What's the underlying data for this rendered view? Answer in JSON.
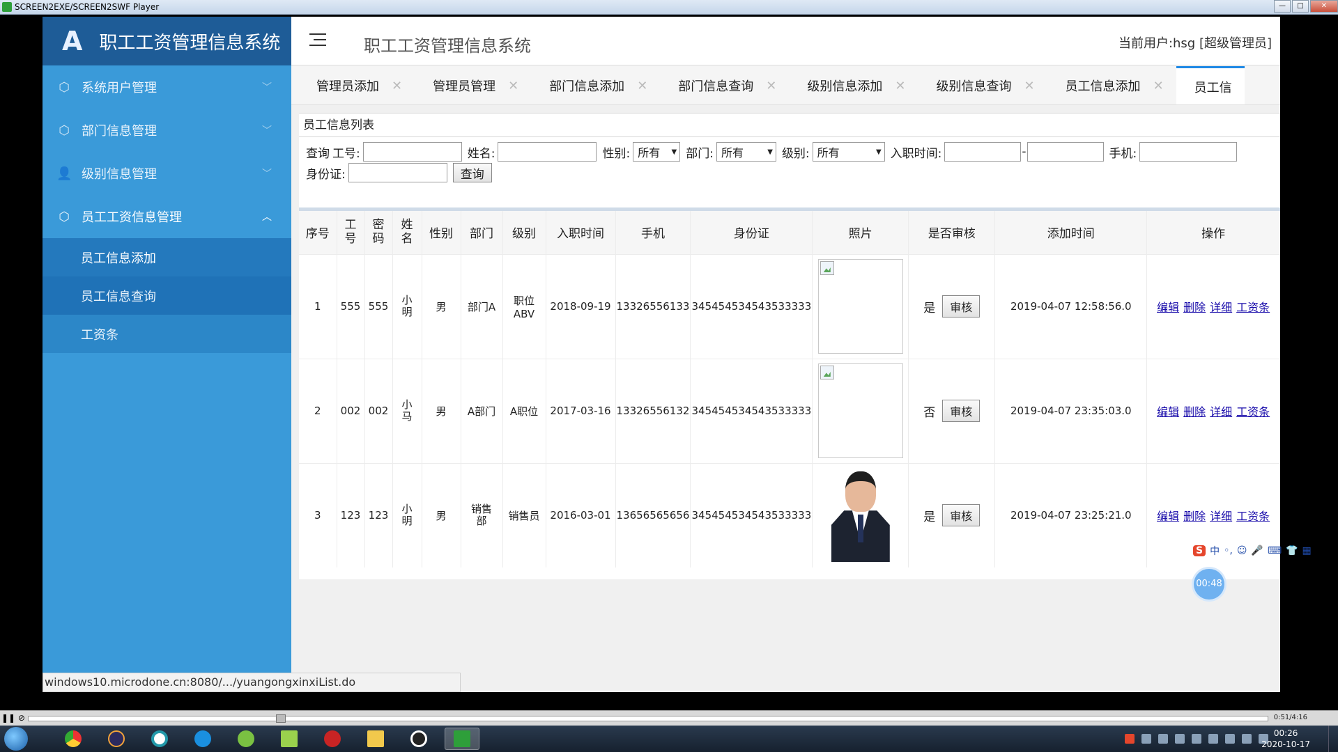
{
  "player": {
    "title": "SCREEN2EXE/SCREEN2SWF Player",
    "elapsed": "0:51/4:16",
    "progress": 0.2
  },
  "app": {
    "brand_logo": "A",
    "brand_title": "职工工资管理信息系统",
    "header_title": "职工工资管理信息系统",
    "current_user": "当前用户:hsg [超级管理员]"
  },
  "sidebar": {
    "menus": [
      {
        "label": "系统用户管理",
        "icon": "cube-icon"
      },
      {
        "label": "部门信息管理",
        "icon": "cube-icon"
      },
      {
        "label": "级别信息管理",
        "icon": "user-icon"
      },
      {
        "label": "员工工资信息管理",
        "icon": "cube-icon"
      }
    ],
    "submenu": [
      {
        "label": "员工信息添加"
      },
      {
        "label": "员工信息查询"
      },
      {
        "label": "工资条"
      }
    ]
  },
  "tabs": [
    {
      "label": "管理员添加"
    },
    {
      "label": "管理员管理"
    },
    {
      "label": "部门信息添加"
    },
    {
      "label": "部门信息查询"
    },
    {
      "label": "级别信息添加"
    },
    {
      "label": "级别信息查询"
    },
    {
      "label": "员工信息添加"
    },
    {
      "label": "员工信"
    }
  ],
  "panel": {
    "title": "员工信息列表"
  },
  "search": {
    "query_label": "查询",
    "job_no_label": "工号:",
    "name_label": "姓名:",
    "gender_label": "性别:",
    "gender_value": "所有",
    "dept_label": "部门:",
    "dept_value": "所有",
    "level_label": "级别:",
    "level_value": "所有",
    "hire_label": "入职时间:",
    "range_dash": "-",
    "phone_label": "手机:",
    "id_label": "身份证:",
    "submit_label": "查询"
  },
  "table": {
    "headers": [
      "序号",
      "工号",
      "密码",
      "姓名",
      "性别",
      "部门",
      "级别",
      "入职时间",
      "手机",
      "身份证",
      "照片",
      "是否审核",
      "添加时间",
      "操作"
    ],
    "audit_button": "审核",
    "ops": [
      "编辑",
      "删除",
      "详细",
      "工资条"
    ],
    "rows": [
      {
        "no": "1",
        "job_no": "555",
        "password": "555",
        "name": "小明",
        "gender": "男",
        "dept": "部门A",
        "level": "职位ABV",
        "hire_date": "2018-09-19",
        "phone": "13326556133",
        "id_card": "345454534543533333",
        "photo": "broken",
        "audited": "是",
        "added": "2019-04-07 12:58:56.0"
      },
      {
        "no": "2",
        "job_no": "002",
        "password": "002",
        "name": "小马",
        "gender": "男",
        "dept": "A部门",
        "level": "A职位",
        "hire_date": "2017-03-16",
        "phone": "13326556132",
        "id_card": "345454534543533333",
        "photo": "broken",
        "audited": "否",
        "added": "2019-04-07 23:35:03.0"
      },
      {
        "no": "3",
        "job_no": "123",
        "password": "123",
        "name": "小明",
        "gender": "男",
        "dept": "销售部",
        "level": "销售员",
        "hire_date": "2016-03-01",
        "phone": "13656565656",
        "id_card": "345454534543533333",
        "photo": "portrait",
        "audited": "是",
        "added": "2019-04-07 23:25:21.0"
      }
    ]
  },
  "status_url": "windows10.microdone.cn:8080/.../yuangongxinxiList.do",
  "ime": {
    "logo": "S",
    "mode": "中"
  },
  "timer_badge": "00:48",
  "taskbar": {
    "time": "00:26",
    "date": "2020-10-17"
  }
}
